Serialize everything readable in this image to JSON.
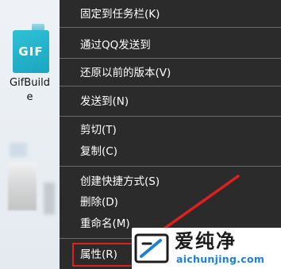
{
  "desktop": {
    "tile_text": "GIF",
    "icon_label_line1": "GifBuild",
    "icon_label_line2": "e"
  },
  "menu": {
    "items": [
      {
        "label": "固定到任务栏(K)"
      },
      {
        "label": "通过QQ发送到"
      },
      {
        "label": "还原以前的版本(V)"
      },
      {
        "label": "发送到(N)"
      },
      {
        "label": "剪切(T)"
      },
      {
        "label": "复制(C)"
      },
      {
        "label": "创建快捷方式(S)"
      },
      {
        "label": "删除(D)"
      },
      {
        "label": "重命名(M)"
      },
      {
        "label": "属性(R)"
      }
    ],
    "highlighted_item": "属性(R)"
  },
  "watermark": {
    "title": "爱纯净",
    "url": "aichunjing.com"
  },
  "colors": {
    "menu_background": "#2b2b2b",
    "highlight_border": "#e21f1f",
    "arrow": "#e21f1f",
    "logo_blue": "#1e7fd6",
    "tile": "#1aa6bf"
  }
}
